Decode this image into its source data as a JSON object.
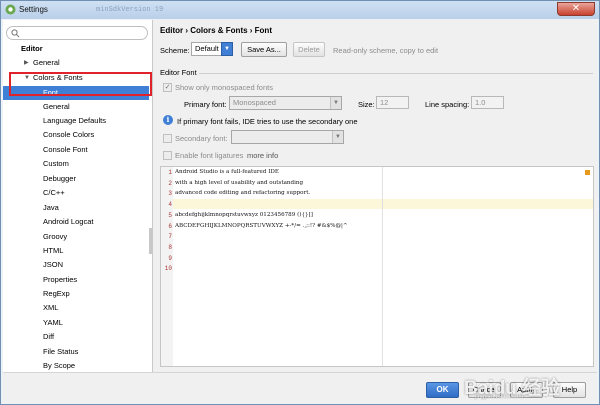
{
  "window": {
    "title": "Settings",
    "background_text": "minSdkVersion 19",
    "close_label": "✕"
  },
  "sidebar": {
    "items": [
      {
        "label": "Editor",
        "level": 0,
        "bold": true
      },
      {
        "label": "General",
        "level": 1,
        "collapsed": true
      },
      {
        "label": "Colors & Fonts",
        "level": 1,
        "expanded": true
      },
      {
        "label": "Font",
        "level": 2,
        "selected": true
      },
      {
        "label": "General",
        "level": 2
      },
      {
        "label": "Language Defaults",
        "level": 2
      },
      {
        "label": "Console Colors",
        "level": 2
      },
      {
        "label": "Console Font",
        "level": 2
      },
      {
        "label": "Custom",
        "level": 2
      },
      {
        "label": "Debugger",
        "level": 2
      },
      {
        "label": "C/C++",
        "level": 2
      },
      {
        "label": "Java",
        "level": 2
      },
      {
        "label": "Android Logcat",
        "level": 2
      },
      {
        "label": "Groovy",
        "level": 2
      },
      {
        "label": "HTML",
        "level": 2
      },
      {
        "label": "JSON",
        "level": 2
      },
      {
        "label": "Properties",
        "level": 2
      },
      {
        "label": "RegExp",
        "level": 2
      },
      {
        "label": "XML",
        "level": 2
      },
      {
        "label": "YAML",
        "level": 2
      },
      {
        "label": "Diff",
        "level": 2
      },
      {
        "label": "File Status",
        "level": 2
      },
      {
        "label": "By Scope",
        "level": 2
      }
    ]
  },
  "main": {
    "breadcrumb": "Editor › Colors & Fonts › Font",
    "scheme": {
      "label": "Scheme:",
      "value": "Default",
      "save_as": "Save As...",
      "delete": "Delete",
      "note": "Read-only scheme, copy to edit"
    },
    "editor_font": {
      "section_title": "Editor Font",
      "show_mono": {
        "label": "Show only monospaced fonts",
        "checked": true
      },
      "primary_font": {
        "label": "Primary font:",
        "value": "Monospaced"
      },
      "size": {
        "label": "Size:",
        "value": "12"
      },
      "line_spacing": {
        "label": "Line spacing:",
        "value": "1.0"
      },
      "info_text": "If primary font fails, IDE tries to use the secondary one",
      "secondary_font": {
        "label": "Secondary font:",
        "value": ""
      },
      "ligatures": {
        "label": "Enable font ligatures",
        "more": "more info"
      }
    },
    "preview": {
      "lines": [
        {
          "n": "1",
          "text": "Android Studio is a full-featured IDE"
        },
        {
          "n": "2",
          "text": "with a high level of usability and outstanding"
        },
        {
          "n": "3",
          "text": "advanced code editing and refactoring support."
        },
        {
          "n": "4",
          "text": ""
        },
        {
          "n": "5",
          "text": "abcdefghijklmnopqrstuvwxyz 0123456789 (){}[]"
        },
        {
          "n": "6",
          "text": "ABCDEFGHIJKLMNOPQRSTUVWXYZ +-*/= .,;:!? #&$%@|^"
        },
        {
          "n": "7",
          "text": ""
        },
        {
          "n": "8",
          "text": ""
        },
        {
          "n": "9",
          "text": ""
        },
        {
          "n": "10",
          "text": ""
        }
      ]
    }
  },
  "footer": {
    "ok": "OK",
    "cancel": "Cancel",
    "apply": "Apply",
    "help": "Help"
  },
  "watermark": {
    "text": "Baidu 经验",
    "sub": "jingyan.baidu.com"
  },
  "colors": {
    "selection": "#3f7fd6",
    "highlight_box": "#e0232a",
    "current_line": "#fdf7d9"
  }
}
